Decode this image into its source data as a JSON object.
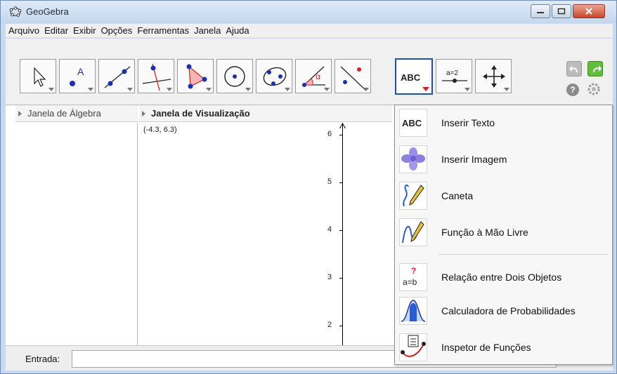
{
  "window": {
    "title": "GeoGebra",
    "accent": "#1f4fa8"
  },
  "menu": [
    "Arquivo",
    "Editar",
    "Exibir",
    "Opções",
    "Ferramentas",
    "Janela",
    "Ajuda"
  ],
  "toolbar": {
    "tools": [
      {
        "name": "move-tool-icon"
      },
      {
        "name": "point-tool-icon",
        "badge": "A"
      },
      {
        "name": "line-tool-icon"
      },
      {
        "name": "perpendicular-tool-icon"
      },
      {
        "name": "polygon-tool-icon"
      },
      {
        "name": "circle-tool-icon"
      },
      {
        "name": "conic-tool-icon"
      },
      {
        "name": "angle-tool-icon",
        "badge": "α"
      },
      {
        "name": "reflect-tool-icon"
      },
      {
        "name": "text-tool-icon",
        "badge": "ABC"
      },
      {
        "name": "slider-tool-icon",
        "badge": "a=2"
      },
      {
        "name": "move-view-tool-icon"
      }
    ]
  },
  "panes": {
    "algebra_title": "Janela de Álgebra",
    "graphics_title": "Janela de Visualização",
    "coord_readout": "(-4.3, 6.3)",
    "y_ticks": [
      "6",
      "5",
      "4",
      "3",
      "2"
    ]
  },
  "input": {
    "label": "Entrada:",
    "value": ""
  },
  "dropdown": {
    "items": [
      {
        "label": "Inserir Texto",
        "icon": "text-icon"
      },
      {
        "label": "Inserir Imagem",
        "icon": "image-icon"
      },
      {
        "label": "Caneta",
        "icon": "pen-icon"
      },
      {
        "label": "Função à Mão Livre",
        "icon": "freehand-function-icon"
      },
      {
        "label": "Relação entre Dois Objetos",
        "icon": "relation-icon"
      },
      {
        "label": "Calculadora de Probabilidades",
        "icon": "probability-calculator-icon"
      },
      {
        "label": "Inspetor de Funções",
        "icon": "function-inspector-icon"
      }
    ]
  }
}
